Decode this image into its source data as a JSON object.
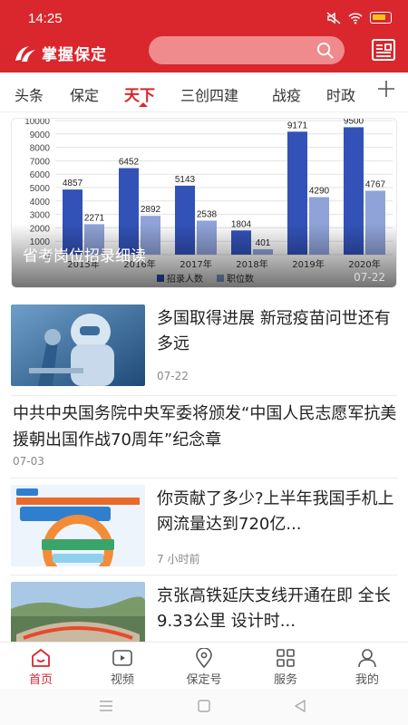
{
  "status_bar": {
    "time": "14:25"
  },
  "app": {
    "name": "掌握保定",
    "brand_color": "#d9272d"
  },
  "search": {
    "icon": "search-icon"
  },
  "tabs": [
    {
      "label": "头条",
      "active": false
    },
    {
      "label": "保定",
      "active": false
    },
    {
      "label": "天下",
      "active": true
    },
    {
      "label": "三创四建",
      "active": false
    },
    {
      "label": "战疫",
      "active": false
    },
    {
      "label": "时政",
      "active": false
    }
  ],
  "banner": {
    "caption": "省考岗位招录细读",
    "date": "07-22",
    "chart_data": {
      "type": "bar",
      "categories": [
        "2015年",
        "2016年",
        "2017年",
        "2018年",
        "2019年",
        "2020年"
      ],
      "series": [
        {
          "name": "招录人数",
          "values": [
            4857,
            6452,
            5143,
            1804,
            9171,
            9500
          ],
          "color": "#3352b8"
        },
        {
          "name": "职位数",
          "values": [
            2271,
            2892,
            2538,
            401,
            4290,
            4767
          ],
          "color": "#8fa3d8"
        }
      ],
      "value_labels": [
        [
          "4857",
          "6452",
          "5143",
          "1804",
          "9171",
          "9500"
        ],
        [
          "2271",
          "2892",
          "2538",
          "401",
          "4290",
          "4767"
        ]
      ],
      "y_ticks": [
        "0",
        "1000",
        "2000",
        "3000",
        "4000",
        "5000",
        "6000",
        "7000",
        "8000",
        "9000",
        "10000"
      ],
      "ylim": [
        0,
        10000
      ],
      "grid": true,
      "legend_position": "bottom"
    }
  },
  "articles": [
    {
      "title": "多国取得进展 新冠疫苗问世还有多远",
      "date": "07-22"
    },
    {
      "title": "中共中央国务院中央军委将颁发“中国人民志愿军抗美援朝出国作战70周年”纪念章",
      "date": "07-03"
    },
    {
      "title": "你贡献了多少?上半年我国手机上网流量达到720亿...",
      "date": "7 小时前"
    },
    {
      "title": "京张高铁延庆支线开通在即 全长9.33公里 设计时..."
    }
  ],
  "bottom_nav": [
    {
      "label": "首页",
      "icon": "home-icon",
      "active": true
    },
    {
      "label": "视频",
      "icon": "video-icon",
      "active": false
    },
    {
      "label": "保定号",
      "icon": "location-icon",
      "active": false
    },
    {
      "label": "服务",
      "icon": "grid-icon",
      "active": false
    },
    {
      "label": "我的",
      "icon": "user-icon",
      "active": false
    }
  ]
}
